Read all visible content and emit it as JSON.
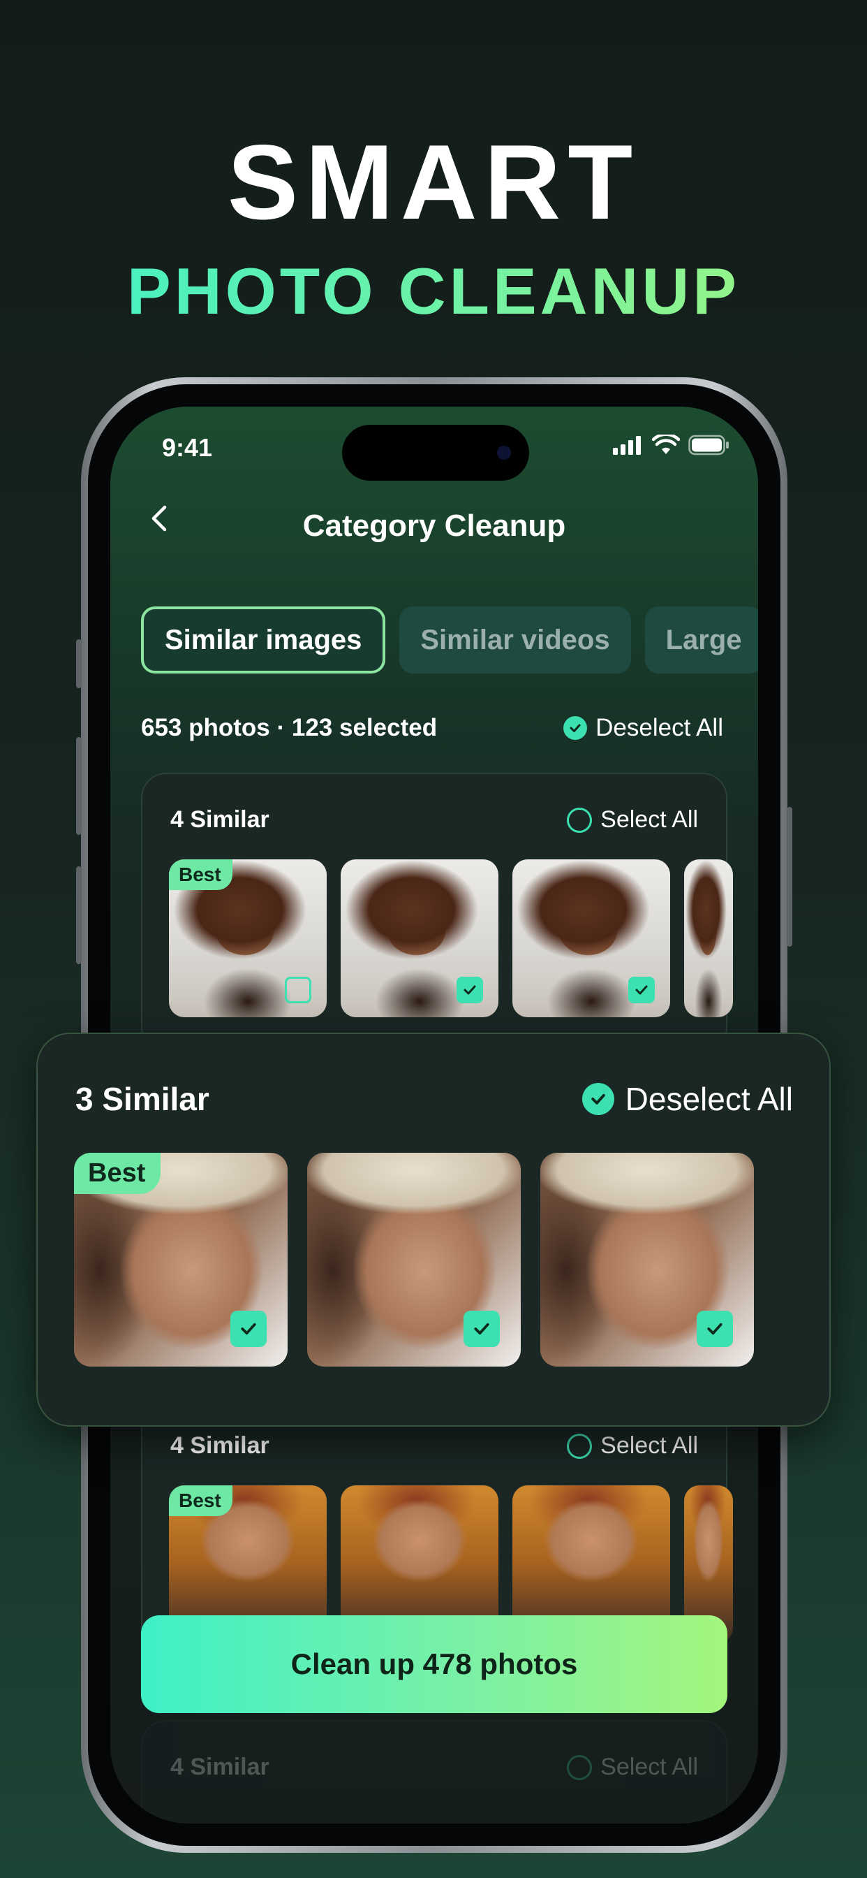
{
  "headline": {
    "line1": "SMART",
    "line2": "PHOTO CLEANUP"
  },
  "status_bar": {
    "time": "9:41",
    "icons": [
      "signal-icon",
      "wifi-icon",
      "battery-icon"
    ]
  },
  "nav": {
    "title": "Category Cleanup",
    "back_icon": "chevron-left-icon"
  },
  "tabs": [
    {
      "label": "Similar images",
      "active": true
    },
    {
      "label": "Similar videos",
      "active": false
    },
    {
      "label": "Large",
      "active": false
    }
  ],
  "summary": {
    "text": "653 photos · 123 selected",
    "action": "Deselect All"
  },
  "groups": [
    {
      "title": "4 Similar",
      "action": "Select All",
      "best_label": "Best",
      "checks": [
        false,
        true,
        true
      ]
    },
    {
      "title": "4 Similar",
      "action": "Select All",
      "best_label": "Best"
    },
    {
      "title": "4 Similar",
      "action": "Select All"
    }
  ],
  "popup": {
    "title": "3 Similar",
    "action": "Deselect All",
    "best_label": "Best",
    "checks": [
      true,
      true,
      true
    ]
  },
  "cta": {
    "label": "Clean up 478 photos"
  },
  "colors": {
    "accent": "#3de0b0",
    "gradient_start": "#3ef0c6",
    "gradient_end": "#a4f57c",
    "card": "#1a2725"
  }
}
